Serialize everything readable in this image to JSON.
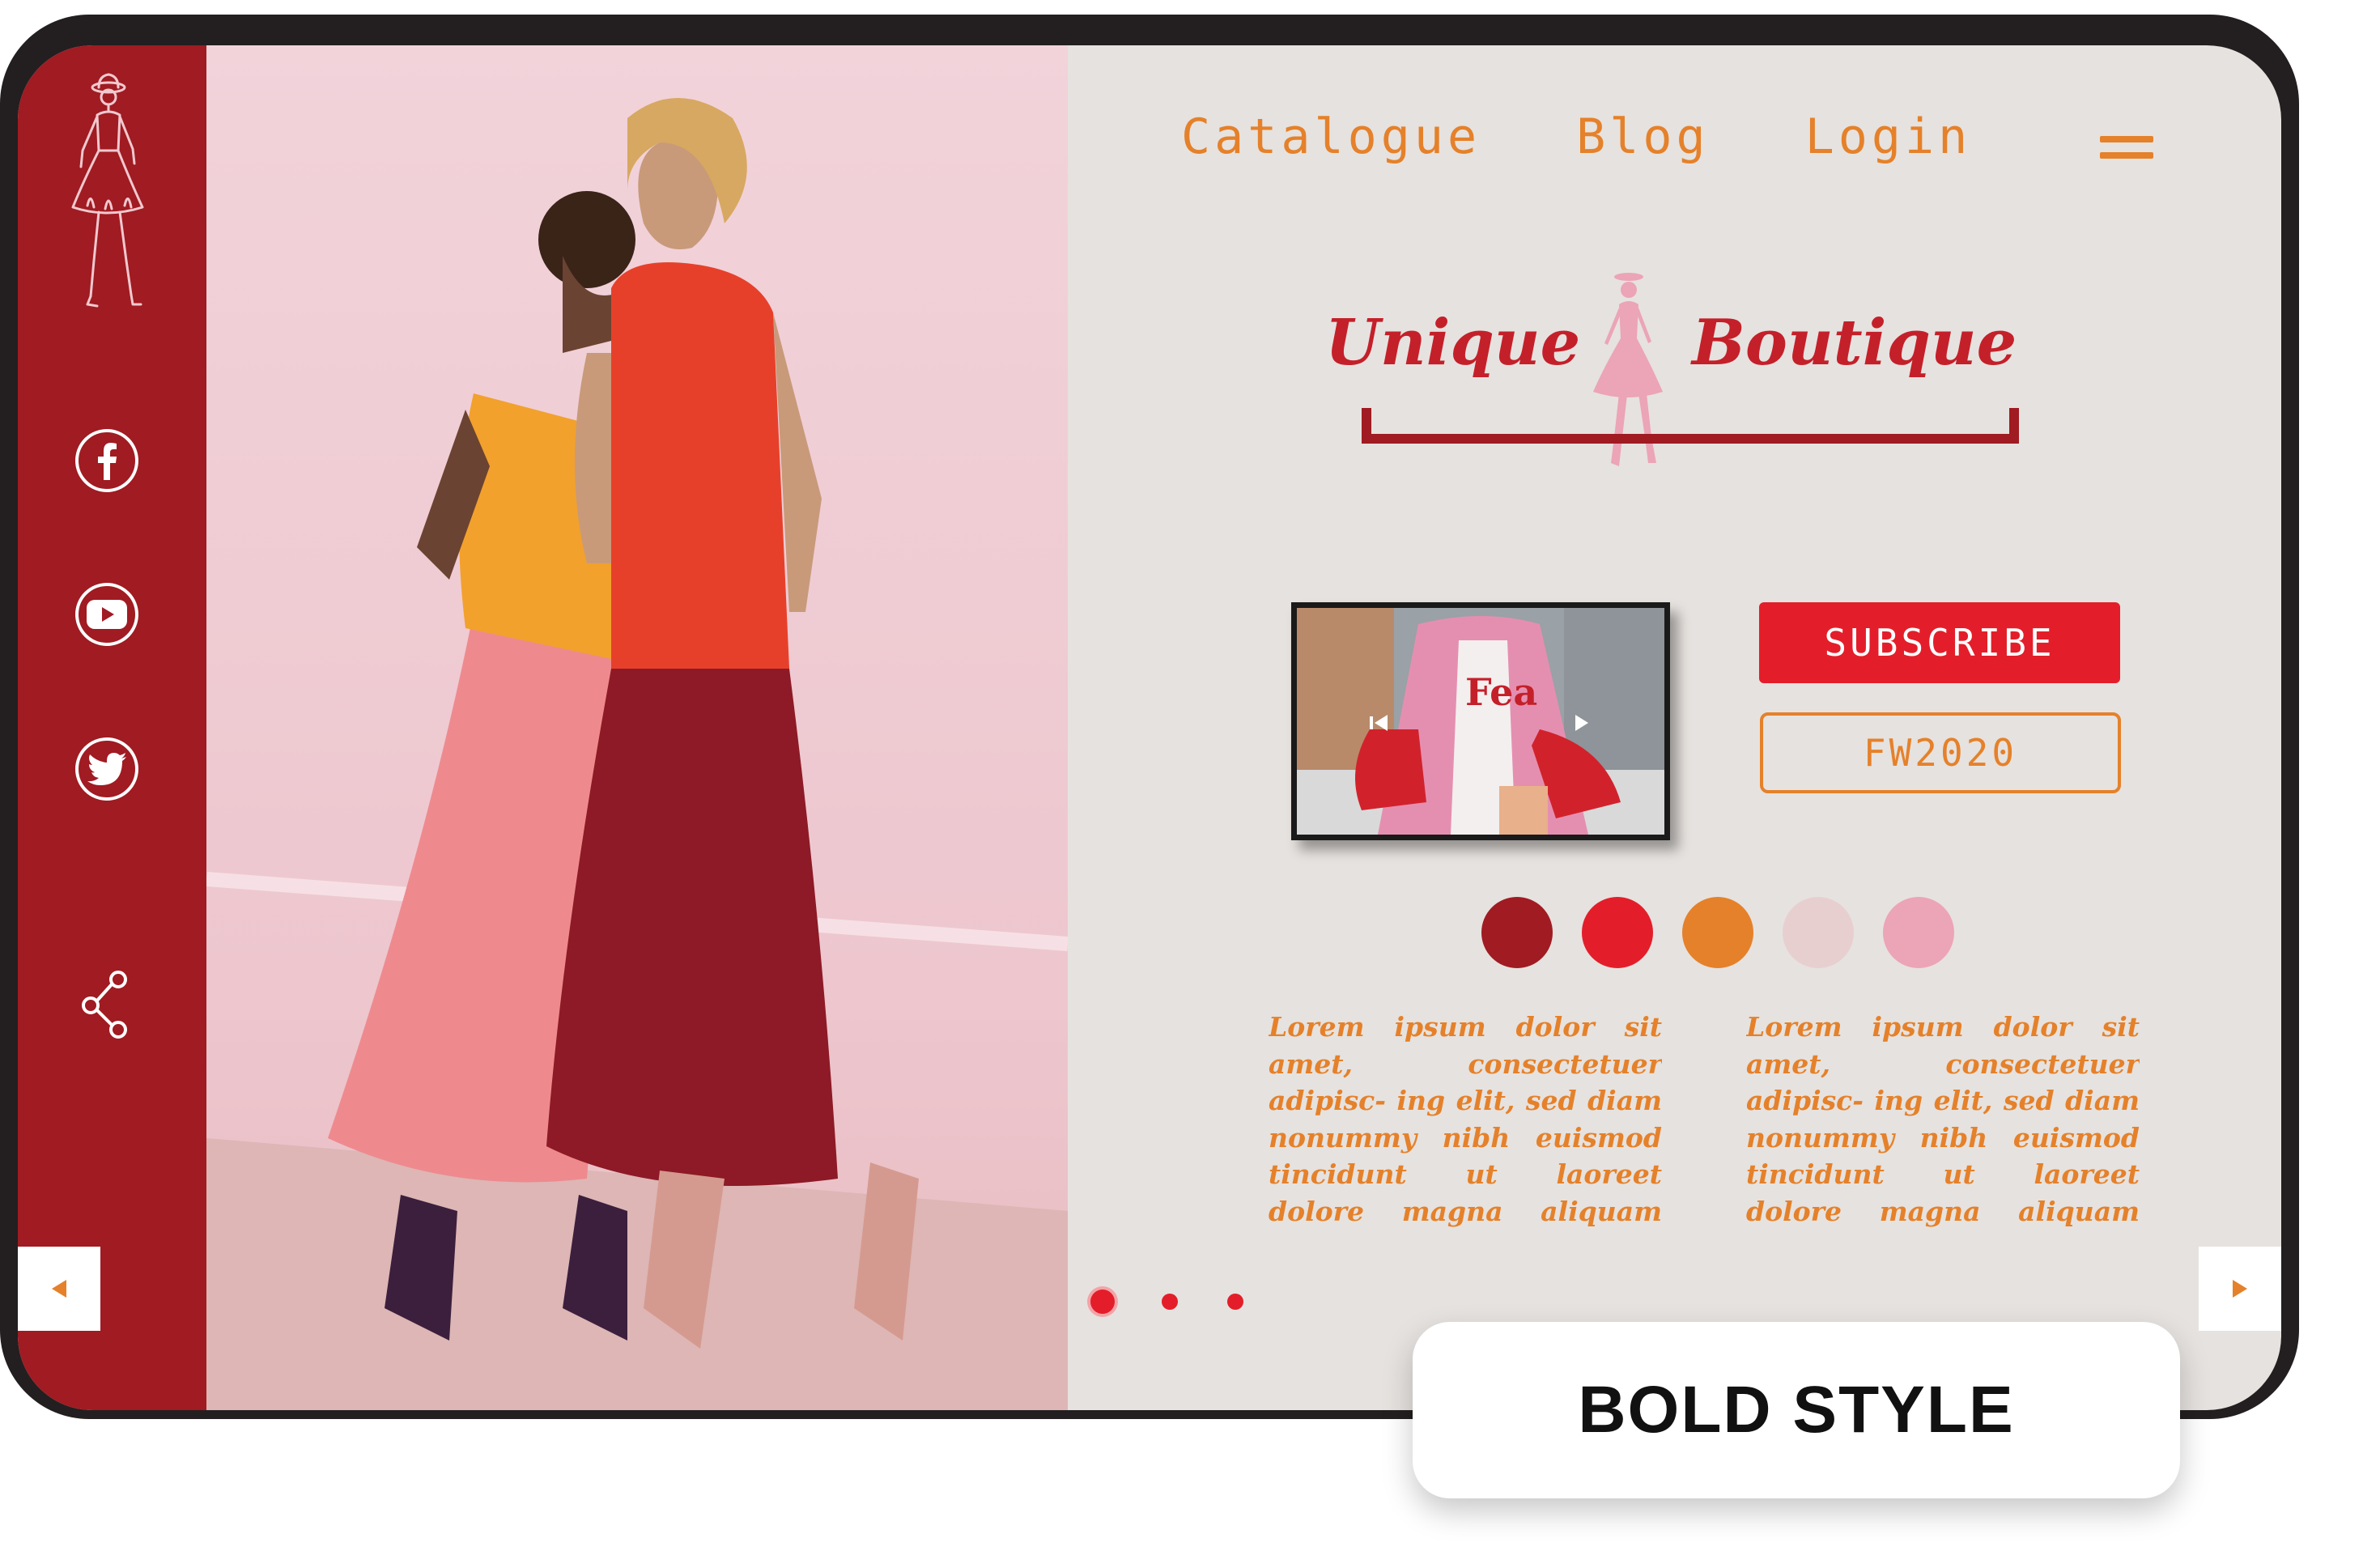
{
  "nav": {
    "items": [
      {
        "label": "Catalogue"
      },
      {
        "label": "Blog"
      },
      {
        "label": "Login"
      }
    ],
    "menu_icon": "hamburger-icon"
  },
  "logo": {
    "left": "Unique",
    "right": "Boutique",
    "icon": "fashion-figure-icon"
  },
  "sidebar": {
    "social": [
      {
        "icon": "facebook-icon"
      },
      {
        "icon": "youtube-icon"
      },
      {
        "icon": "twitter-icon"
      }
    ],
    "share_icon": "share-icon"
  },
  "video": {
    "prev_icon": "skip-back-icon",
    "next_icon": "skip-forward-icon"
  },
  "buttons": {
    "subscribe": "SUBSCRIBE",
    "collection": "FW2020"
  },
  "palette": [
    "#a01b22",
    "#e31e2a",
    "#e5812a",
    "#e8cfcf",
    "#eca4b7"
  ],
  "columns": [
    {
      "text": "Lorem ipsum dolor sit amet, consectetuer adipisc- ing elit, sed diam nonummy nibh euismod tincidunt ut laoreet dolore magna aliquam erat volutpat. Ut"
    },
    {
      "text": "Lorem ipsum dolor sit amet, consectetuer adipisc- ing elit, sed diam nonummy nibh euismod tincidunt ut laoreet dolore magna aliquam erat volutpat. Ut"
    }
  ],
  "carousel": {
    "count": 3,
    "active": 1
  },
  "badge": {
    "label": "BOLD STYLE"
  },
  "colors": {
    "brand_red": "#a01b22",
    "accent_red": "#e31e2a",
    "orange": "#e5812a",
    "background": "#e6e2df"
  }
}
